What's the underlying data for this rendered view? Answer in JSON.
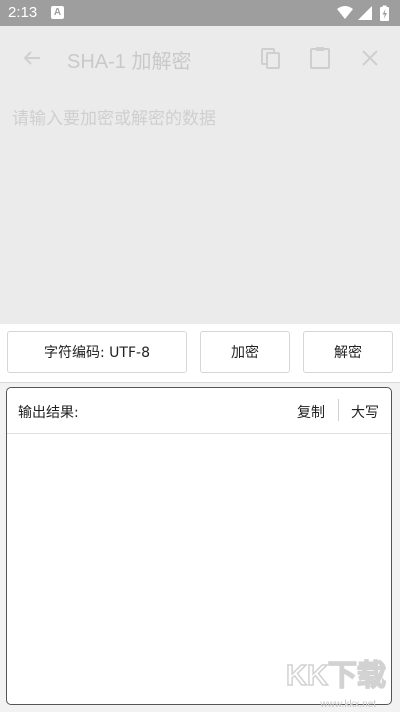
{
  "status_bar": {
    "time": "2:13",
    "notification_badge": "A"
  },
  "toolbar": {
    "title": "SHA-1 加解密",
    "icons": [
      "back-arrow-icon",
      "copy-icon",
      "paste-icon",
      "close-icon"
    ]
  },
  "input": {
    "placeholder": "请输入要加密或解密的数据"
  },
  "controls": {
    "encoding_label": "字符编码: UTF-8",
    "encrypt_label": "加密",
    "decrypt_label": "解密"
  },
  "output": {
    "label": "输出结果:",
    "copy_label": "复制",
    "uppercase_label": "大写",
    "value": ""
  },
  "watermark": {
    "text": "KK下载",
    "url": "www.kkx.net"
  }
}
